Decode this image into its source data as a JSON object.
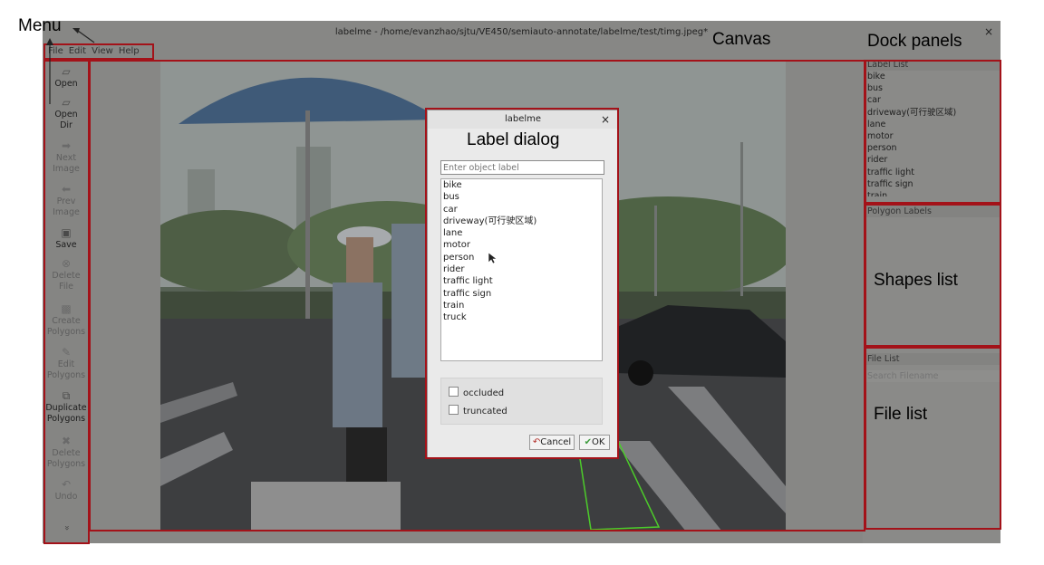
{
  "window": {
    "title": "labelme - /home/evanzhao/sjtu/VE450/semiauto-annotate/labelme/test/timg.jpeg*",
    "close_icon": "×"
  },
  "menubar": {
    "items": [
      "File",
      "Edit",
      "View",
      "Help"
    ]
  },
  "toolbar": {
    "open": [
      "Open"
    ],
    "open_dir": [
      "Open",
      "Dir"
    ],
    "next_image": [
      "Next",
      "Image"
    ],
    "prev_image": [
      "Prev",
      "Image"
    ],
    "save": [
      "Save"
    ],
    "delete_file": [
      "Delete",
      "File"
    ],
    "create_polygons": [
      "Create",
      "Polygons"
    ],
    "edit_polygons": [
      "Edit",
      "Polygons"
    ],
    "duplicate_polygons": [
      "Duplicate",
      "Polygons"
    ],
    "delete_polygons": [
      "Delete",
      "Polygons"
    ],
    "undo": [
      "Undo"
    ],
    "more": "»"
  },
  "label_list": {
    "title": "Label List",
    "items": [
      "bike",
      "bus",
      "car",
      "driveway(可行驶区域)",
      "lane",
      "motor",
      "person",
      "rider",
      "traffic light",
      "traffic sign",
      "train"
    ]
  },
  "polygon_labels": {
    "title": "Polygon Labels"
  },
  "file_list": {
    "title": "File List",
    "search_placeholder": "Search Filename"
  },
  "dialog": {
    "title": "labelme",
    "close_icon": "×",
    "input_placeholder": "Enter object label",
    "labels": [
      "bike",
      "bus",
      "car",
      "driveway(可行驶区域)",
      "lane",
      "motor",
      "person",
      "rider",
      "traffic light",
      "traffic sign",
      "train",
      "truck"
    ],
    "flags": [
      "occluded",
      "truncated"
    ],
    "cancel_label": "Cancel",
    "ok_label": "OK"
  },
  "annotations": {
    "menu": "Menu",
    "canvas": "Canvas",
    "dock_panels": "Dock panels",
    "label_dialog": "Label dialog",
    "shapes_list": "Shapes list",
    "file_list": "File list"
  },
  "colors": {
    "annotation_box": "#a31219",
    "polygon_outline": "#4ccc2a"
  }
}
